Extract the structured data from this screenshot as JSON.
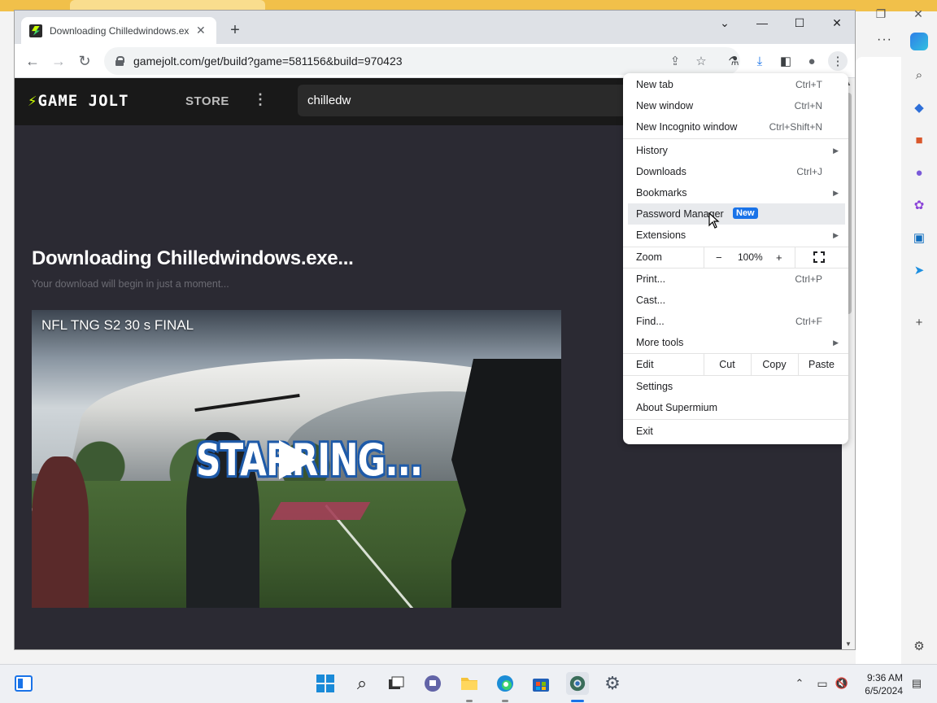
{
  "chrome": {
    "tab_title": "Downloading Chilledwindows.exe",
    "new_tab_symbol": "+",
    "url": "gamejolt.com/get/build?game=581156&build=970423"
  },
  "page": {
    "logo": "GAME JOLT",
    "store": "STORE",
    "search_value": "chilledw",
    "title": "Downloading Chilledwindows.exe...",
    "subtitle": "Your download will begin in just a moment...",
    "video_title": "NFL TNG S2 30 s FINAL",
    "video_overlay": "STARRING..."
  },
  "menu": {
    "new_tab": {
      "label": "New tab",
      "shortcut": "Ctrl+T"
    },
    "new_window": {
      "label": "New window",
      "shortcut": "Ctrl+N"
    },
    "new_incognito": {
      "label": "New Incognito window",
      "shortcut": "Ctrl+Shift+N"
    },
    "history": {
      "label": "History"
    },
    "downloads": {
      "label": "Downloads",
      "shortcut": "Ctrl+J"
    },
    "bookmarks": {
      "label": "Bookmarks"
    },
    "password_manager": {
      "label": "Password Manager",
      "badge": "New"
    },
    "extensions": {
      "label": "Extensions"
    },
    "zoom": {
      "label": "Zoom",
      "minus": "−",
      "value": "100%",
      "plus": "+"
    },
    "print": {
      "label": "Print...",
      "shortcut": "Ctrl+P"
    },
    "cast": {
      "label": "Cast..."
    },
    "find": {
      "label": "Find...",
      "shortcut": "Ctrl+F"
    },
    "more_tools": {
      "label": "More tools"
    },
    "edit": {
      "label": "Edit",
      "cut": "Cut",
      "copy": "Copy",
      "paste": "Paste"
    },
    "settings": {
      "label": "Settings"
    },
    "about": {
      "label": "About Supermium"
    },
    "exit": {
      "label": "Exit"
    }
  },
  "taskbar": {
    "time": "9:36 AM",
    "date": "6/5/2024"
  },
  "colors": {
    "accent": "#1a73e8",
    "gamejolt_green": "#ccff00",
    "page_bg": "#2b2a33"
  }
}
